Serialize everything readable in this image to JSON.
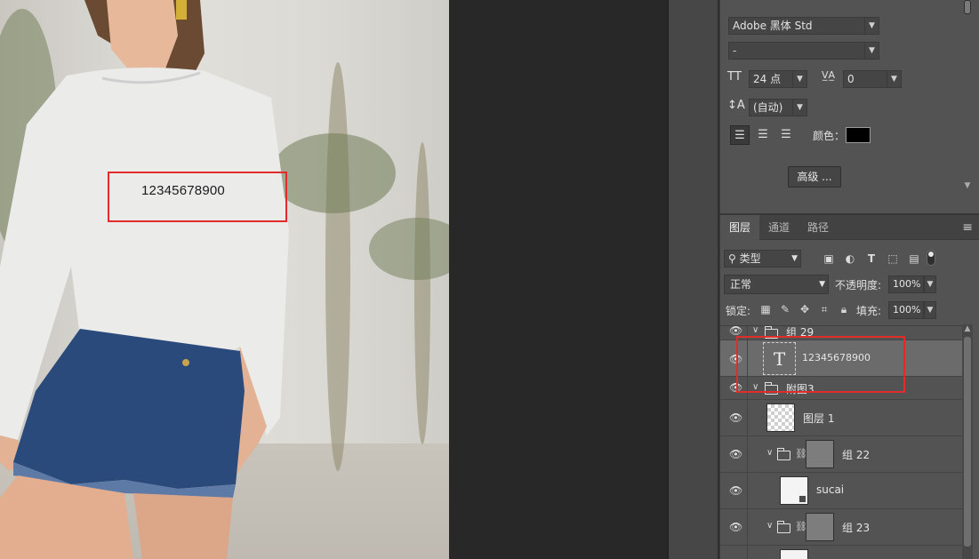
{
  "canvas": {
    "overlay_text": "12345678900"
  },
  "character": {
    "font_family": "Adobe 黑体 Std",
    "font_style": "-",
    "font_size": "24 点",
    "tracking": "0",
    "leading": "(自动)",
    "color_label": "颜色：",
    "advanced_button": "高级 ...",
    "icons": {
      "size": "text-size-icon",
      "kerning": "kerning-va-icon",
      "leading": "leading-icon",
      "align_left": "align-left-icon",
      "align_center": "align-center-icon",
      "align_right": "align-right-icon"
    },
    "text_color": "#000000"
  },
  "layers_panel": {
    "tabs": [
      {
        "label": "图层",
        "active": true
      },
      {
        "label": "通道",
        "active": false
      },
      {
        "label": "路径",
        "active": false
      }
    ],
    "filter": {
      "type_label": "类型"
    },
    "blend_mode": "正常",
    "opacity_label": "不透明度:",
    "opacity_value": "100%",
    "lock_label": "锁定:",
    "fill_label": "填充:",
    "fill_value": "100%",
    "layers": [
      {
        "name": "组 29",
        "kind": "group",
        "expanded": true
      },
      {
        "name": "12345678900",
        "kind": "text",
        "selected": true
      },
      {
        "name": "附图3",
        "kind": "group",
        "expanded": true
      },
      {
        "name": "图层 1",
        "kind": "pixel"
      },
      {
        "name": "组 22",
        "kind": "group-with-mask",
        "expanded": true
      },
      {
        "name": "sucai",
        "kind": "smart-object"
      },
      {
        "name": "组 23",
        "kind": "group-with-mask",
        "expanded": true
      }
    ]
  },
  "colors": {
    "panel_bg": "#535353",
    "highlight_red": "#e22b2b",
    "selected_row": "#6b6b6b"
  }
}
